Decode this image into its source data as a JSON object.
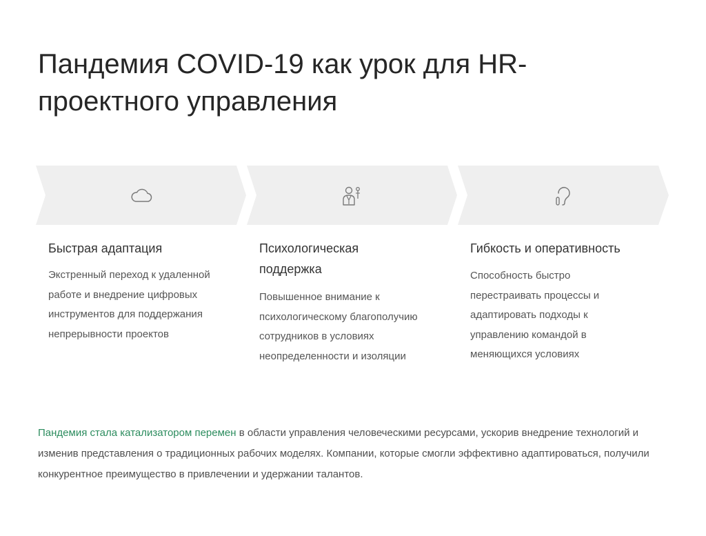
{
  "title": {
    "line1": "Пандемия COVID-19 как урок для HR-",
    "line2": "проектного управления"
  },
  "colors": {
    "accent": "#2c8c5e",
    "arrow_fill": "#efefef"
  },
  "steps": [
    {
      "icon": "cloud-icon",
      "title": "Быстрая адаптация",
      "lines": [
        "Экстренный переход к удаленной",
        "работе и внедрение цифровых",
        "инструментов для поддержания",
        "непрерывности проектов"
      ]
    },
    {
      "icon": "doctor-icon",
      "title_lines": [
        "Психологическая",
        "поддержка"
      ],
      "lines": [
        "Повышенное внимание к",
        "психологическому благополучию",
        "сотрудников в условиях",
        "неопределенности и изоляции"
      ]
    },
    {
      "icon": "ear-icon",
      "title": "Гибкость и оперативность",
      "lines": [
        "Способность быстро",
        "перестраивать процессы и",
        "адаптировать подходы к",
        "управлению командой в",
        "меняющихся условиях"
      ]
    }
  ],
  "summary": {
    "accent": "Пандемия стала катализатором перемен",
    "line1_rest": " в области управления человеческими ресурсами, ускорив внедрение",
    "line2": "технологий и изменив представления о традиционных рабочих моделях. Компании, которые смогли",
    "line3": "эффективно адаптироваться, получили конкурентное преимущество в привлечении и удержании талантов."
  }
}
